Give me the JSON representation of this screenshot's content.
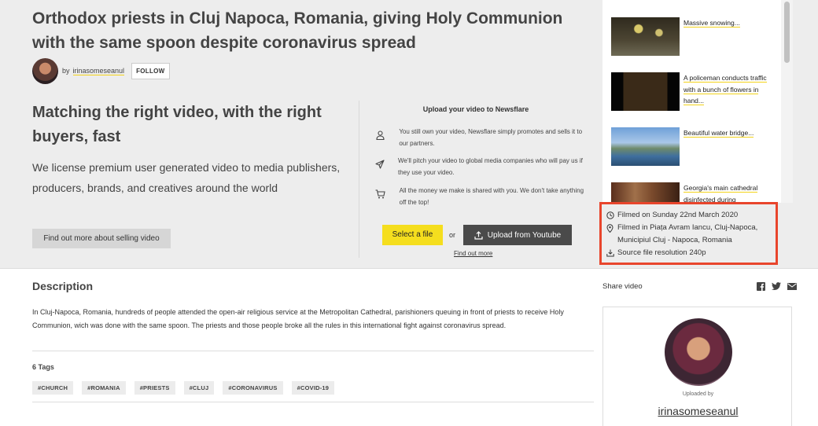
{
  "video": {
    "title": "Orthodox priests in Cluj Napoca, Romania, giving Holy Communion with the same spoon despite coronavirus spread",
    "by_label": "by",
    "author": "irinasomeseanul",
    "follow_label": "FOLLOW"
  },
  "promo": {
    "heading": "Matching the right video, with the right buyers, fast",
    "text": "We license premium user generated video to media publishers, producers, brands, and creatives around the world",
    "cta_label": "Find out more about selling video"
  },
  "upload": {
    "title": "Upload your video to Newsflare",
    "items": [
      {
        "icon": "user-icon",
        "text": "You still own your video, Newsflare simply promotes and sells it to our partners."
      },
      {
        "icon": "send-icon",
        "text": "We'll pitch your video to global media companies who will pay us if they use your video."
      },
      {
        "icon": "cart-icon",
        "text": "All the money we make is shared with you. We don't take anything off the top!"
      }
    ],
    "select_file_label": "Select a file",
    "or_label": "or",
    "youtube_label": "Upload from Youtube",
    "find_out_more": "Find out more"
  },
  "related": [
    {
      "title": "Massive snowing..."
    },
    {
      "title": "A policeman conducts traffic with a bunch of flowers in hand..."
    },
    {
      "title": "Beautiful water bridge..."
    },
    {
      "title": "Georgia's main cathedral disinfected during"
    }
  ],
  "meta": {
    "filmed_on": "Filmed on Sunday 22nd March 2020",
    "filmed_in_line1": "Filmed in Piața Avram Iancu, Cluj-Napoca,",
    "filmed_in_line2": "Municipiul Cluj - Napoca, Romania",
    "resolution": "Source file resolution 240p"
  },
  "description": {
    "title": "Description",
    "text": "In Cluj-Napoca, Romania, hundreds of people attended the open-air religious service at the Metropolitan Cathedral, parishioners queuing in front of priests to receive Holy Communion, wich was done with the same spoon. The priests and those people broke all the rules in this international fight against coronavirus spread.",
    "tags_title": "6 Tags",
    "tags": [
      "#CHURCH",
      "#ROMANIA",
      "#PRIESTS",
      "#CLUJ",
      "#CORONAVIRUS",
      "#COVID-19"
    ]
  },
  "share": {
    "label": "Share video",
    "icons": [
      "facebook-icon",
      "twitter-icon",
      "email-icon"
    ]
  },
  "uploader": {
    "uploaded_by_label": "Uploaded by",
    "name": "irinasomeseanul"
  },
  "colors": {
    "accent_yellow": "#f5de1e",
    "highlight_red": "#e8452c",
    "dark_button": "#4a4a4a"
  }
}
